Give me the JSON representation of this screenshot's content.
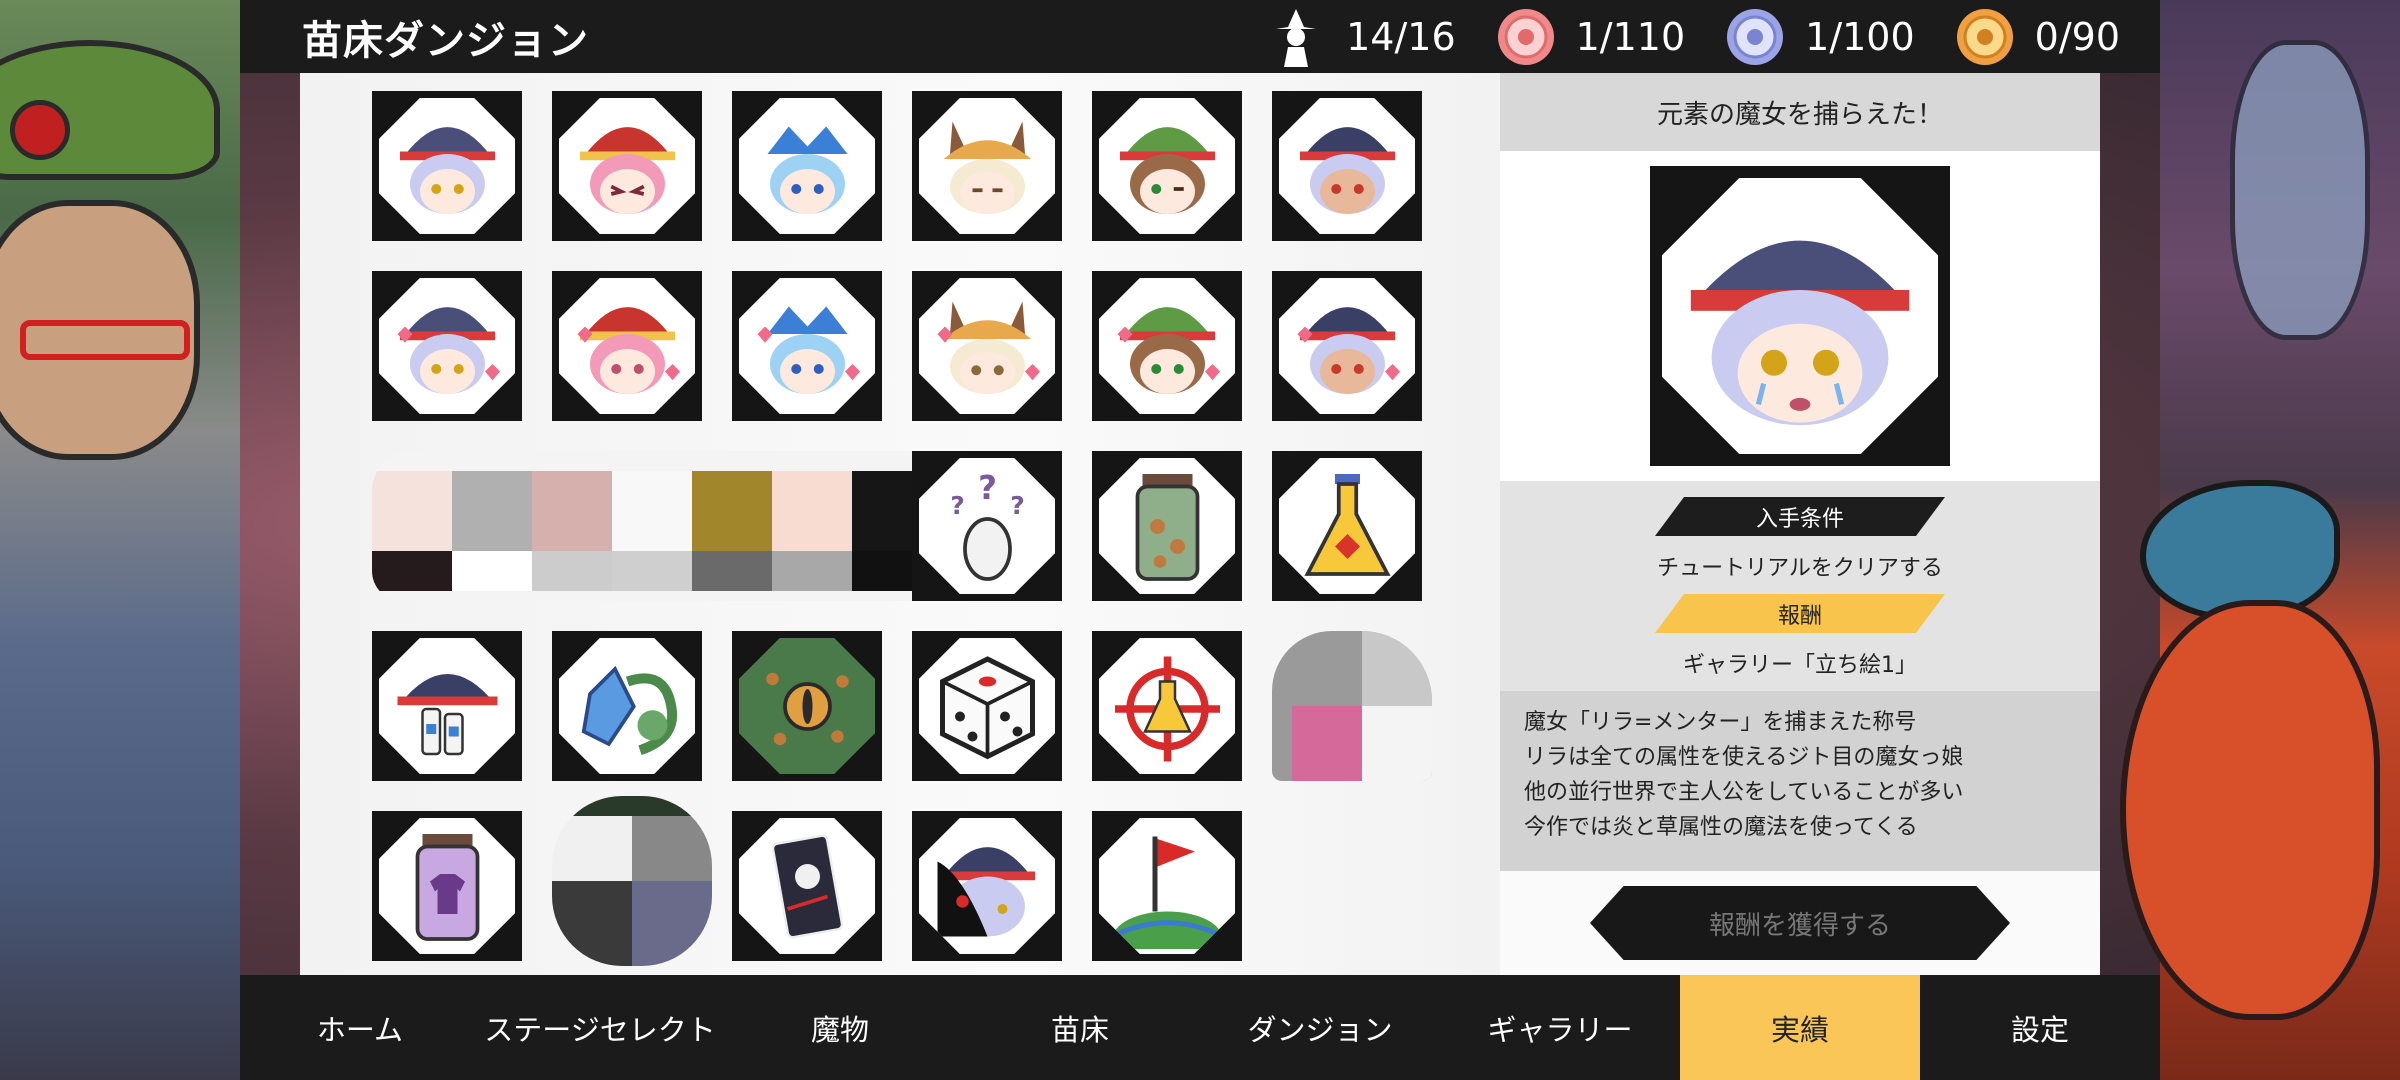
{
  "header": {
    "title": "苗床ダンジョン",
    "stats": [
      {
        "icon": "witch-silhouette-icon",
        "value": "14/16"
      },
      {
        "icon": "pink-medal-icon",
        "value": "1/110"
      },
      {
        "icon": "blue-medal-icon",
        "value": "1/100"
      },
      {
        "icon": "gold-medal-icon",
        "value": "0/90"
      }
    ]
  },
  "grid": {
    "rows": [
      [
        "witch-navy-hat-face",
        "witch-red-hat-face",
        "witch-blue-ribbon-face",
        "witch-bunny-ears-face",
        "witch-green-hat-face",
        "witch-navy-hat-dark-face"
      ],
      [
        "witch-navy-hat-hearts",
        "witch-red-hat-hearts",
        "witch-blue-ribbon-hearts",
        "witch-bunny-ears-hearts",
        "witch-green-hat-hearts",
        "witch-navy-hat-dark-hearts"
      ],
      [
        "mosaic-censored",
        "mosaic-censored",
        "mosaic-censored",
        "mystery-egg-icon",
        "jar-with-eggs-icon"
      ],
      [
        "potion-flask-icon",
        "hat-with-milk-bottles-icon",
        "crystal-vine-icon",
        "monster-eye-icon",
        "dice-icon",
        "crosshair-flask-icon"
      ],
      [
        "mosaic-censored",
        "jar-with-shirt-icon",
        "mosaic-censored",
        "card-icon",
        "shadow-witch-icon",
        "flag-on-globe-icon"
      ]
    ]
  },
  "detail": {
    "heading": "元素の魔女を捕らえた！",
    "portrait": "witch-navy-hat-crying-portrait",
    "condition_label": "入手条件",
    "condition_text": "チュートリアルをクリアする",
    "reward_label": "報酬",
    "reward_text": "ギャラリー「立ち絵1」",
    "description": [
      "魔女「リラ=メンター」を捕まえた称号",
      "リラは全ての属性を使えるジト目の魔女っ娘",
      "他の並行世界で主人公をしていることが多い",
      "今作では炎と草属性の魔法を使ってくる"
    ],
    "claim_button": "報酬を獲得する"
  },
  "nav": {
    "items": [
      "ホーム",
      "ステージセレクト",
      "魔物",
      "苗床",
      "ダンジョン",
      "ギャラリー",
      "実績",
      "設定"
    ],
    "active": "実績"
  },
  "colors": {
    "accent": "#fbc658",
    "bar": "#1b1b1b",
    "panel": "#f5f5f5"
  }
}
